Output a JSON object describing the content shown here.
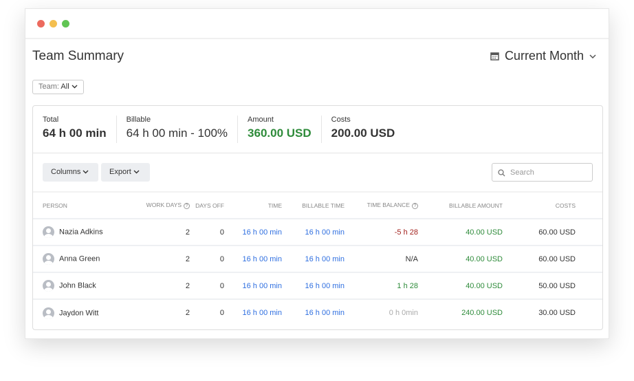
{
  "header": {
    "title": "Team Summary",
    "period": "Current Month",
    "team_label": "Team:",
    "team_value": "All"
  },
  "stats": [
    {
      "label": "Total",
      "value": "64 h 00 min"
    },
    {
      "label": "Billable",
      "value": "64 h 00 min - 100%"
    },
    {
      "label": "Amount",
      "value": "360.00 USD"
    },
    {
      "label": "Costs",
      "value": "200.00 USD"
    }
  ],
  "toolbar": {
    "columns": "Columns",
    "export": "Export",
    "search_placeholder": "Search"
  },
  "table": {
    "headers": [
      "PERSON",
      "WORK DAYS",
      "DAYS OFF",
      "TIME",
      "BILLABLE TIME",
      "TIME BALANCE",
      "BILLABLE AMOUNT",
      "COSTS"
    ],
    "rows": [
      [
        "Nazia Adkins",
        "2",
        "0",
        "16 h 00 min",
        "16 h 00 min",
        "-5 h 28",
        "40.00 USD",
        "60.00 USD"
      ],
      [
        "Anna Green",
        "2",
        "0",
        "16 h 00 min",
        "16 h 00 min",
        "N/A",
        "40.00 USD",
        "60.00 USD"
      ],
      [
        "John Black",
        "2",
        "0",
        "16 h 00 min",
        "16 h 00 min",
        "1 h 28",
        "40.00 USD",
        "50.00 USD"
      ],
      [
        "Jaydon Witt",
        "2",
        "0",
        "16 h 00 min",
        "16 h 00 min",
        "0 h 0min",
        "240.00 USD",
        "30.00 USD"
      ]
    ]
  },
  "colors": {
    "blue": "#2f6fe0",
    "green": "#2e8b3a",
    "red": "#a3231f"
  }
}
